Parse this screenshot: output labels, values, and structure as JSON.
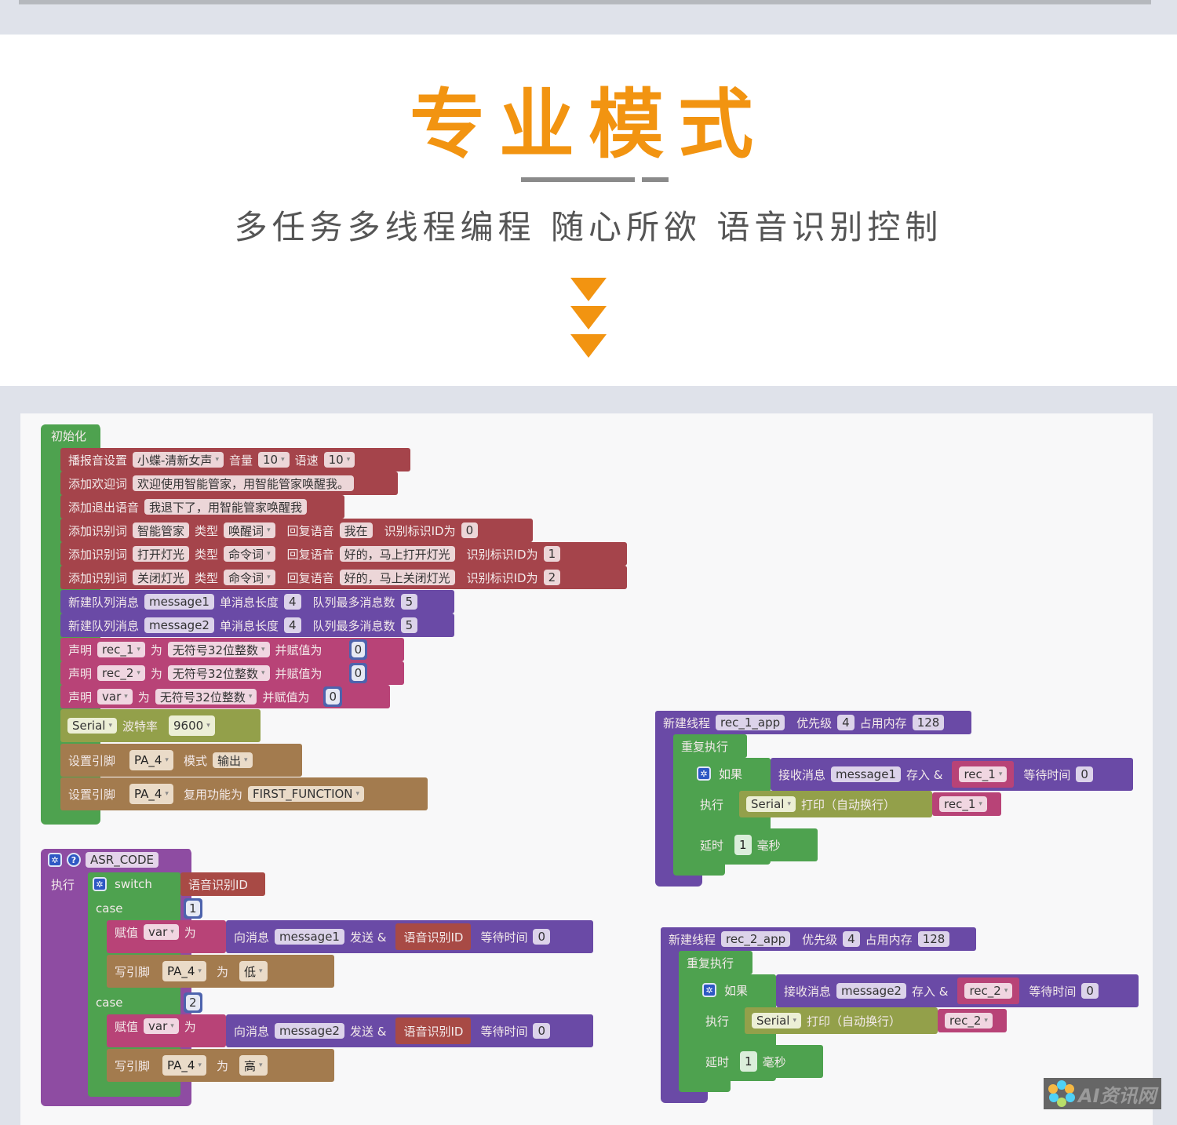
{
  "header": {
    "title": "专业模式",
    "subtitle": "多任务多线程编程  随心所欲  语音识别控制",
    "accent_color": "#f29411"
  },
  "init_block": {
    "label": "初始化",
    "statements": [
      {
        "label": "播报音设置",
        "voice": "小蝶-清新女声",
        "volume_label": "音量",
        "volume": "10",
        "speed_label": "语速",
        "speed": "10"
      },
      {
        "label": "添加欢迎词",
        "text": "欢迎使用智能管家，用智能管家唤醒我。"
      },
      {
        "label": "添加退出语音",
        "text": "我退下了，用智能管家唤醒我"
      },
      {
        "label": "添加识别词",
        "word": "智能管家",
        "type_label": "类型",
        "type": "唤醒词",
        "reply_label": "回复语音",
        "reply": "我在",
        "id_label": "识别标识ID为",
        "id": "0"
      },
      {
        "label": "添加识别词",
        "word": "打开灯光",
        "type_label": "类型",
        "type": "命令词",
        "reply_label": "回复语音",
        "reply": "好的，马上打开灯光",
        "id_label": "识别标识ID为",
        "id": "1"
      },
      {
        "label": "添加识别词",
        "word": "关闭灯光",
        "type_label": "类型",
        "type": "命令词",
        "reply_label": "回复语音",
        "reply": "好的，马上关闭灯光",
        "id_label": "识别标识ID为",
        "id": "2"
      },
      {
        "label": "新建队列消息",
        "name": "message1",
        "len_label": "单消息长度",
        "len": "4",
        "max_label": "队列最多消息数",
        "max": "5"
      },
      {
        "label": "新建队列消息",
        "name": "message2",
        "len_label": "单消息长度",
        "len": "4",
        "max_label": "队列最多消息数",
        "max": "5"
      },
      {
        "label": "声明",
        "var": "rec_1",
        "as_label": "为",
        "type": "无符号32位整数",
        "assign_label": "并赋值为",
        "value": "0"
      },
      {
        "label": "声明",
        "var": "rec_2",
        "as_label": "为",
        "type": "无符号32位整数",
        "assign_label": "并赋值为",
        "value": "0"
      },
      {
        "label": "声明",
        "var": "var",
        "as_label": "为",
        "type": "无符号32位整数",
        "assign_label": "并赋值为",
        "value": "0"
      },
      {
        "port": "Serial",
        "baud_label": "波特率",
        "baud": "9600"
      },
      {
        "label": "设置引脚",
        "pin": "PA_4",
        "mode_label": "模式",
        "mode": "输出"
      },
      {
        "label": "设置引脚",
        "pin": "PA_4",
        "func_label": "复用功能为",
        "func": "FIRST_FUNCTION"
      }
    ]
  },
  "asr_block": {
    "name": "ASR_CODE",
    "exec_label": "执行",
    "switch_label": "switch",
    "switch_value": "语音识别ID",
    "cases": [
      {
        "case_label": "case",
        "value": "1",
        "assign_label": "赋值",
        "var": "var",
        "as_label": "为",
        "send_label": "向消息",
        "msg": "message1",
        "send2_label": "发送 &",
        "payload": "语音识别ID",
        "wait_label": "等待时间",
        "wait": "0",
        "write_label": "写引脚",
        "pin": "PA_4",
        "to_label": "为",
        "level": "低"
      },
      {
        "case_label": "case",
        "value": "2",
        "assign_label": "赋值",
        "var": "var",
        "as_label": "为",
        "send_label": "向消息",
        "msg": "message2",
        "send2_label": "发送 &",
        "payload": "语音识别ID",
        "wait_label": "等待时间",
        "wait": "0",
        "write_label": "写引脚",
        "pin": "PA_4",
        "to_label": "为",
        "level": "高"
      }
    ]
  },
  "threads": [
    {
      "label": "新建线程",
      "name": "rec_1_app",
      "prio_label": "优先级",
      "prio": "4",
      "mem_label": "占用内存",
      "mem": "128",
      "loop_label": "重复执行",
      "if_label": "如果",
      "recv_label": "接收消息",
      "msg": "message1",
      "store_label": "存入 &",
      "var": "rec_1",
      "wait_label": "等待时间",
      "wait": "0",
      "exec_label": "执行",
      "port": "Serial",
      "print_label": "打印（自动换行）",
      "print_var": "rec_1",
      "delay_label": "延时",
      "delay": "1",
      "unit": "毫秒"
    },
    {
      "label": "新建线程",
      "name": "rec_2_app",
      "prio_label": "优先级",
      "prio": "4",
      "mem_label": "占用内存",
      "mem": "128",
      "loop_label": "重复执行",
      "if_label": "如果",
      "recv_label": "接收消息",
      "msg": "message2",
      "store_label": "存入 &",
      "var": "rec_2",
      "wait_label": "等待时间",
      "wait": "0",
      "exec_label": "执行",
      "port": "Serial",
      "print_label": "打印（自动换行）",
      "print_var": "rec_2",
      "delay_label": "延时",
      "delay": "1",
      "unit": "毫秒"
    }
  ],
  "watermark": {
    "text": "AI资讯网"
  }
}
